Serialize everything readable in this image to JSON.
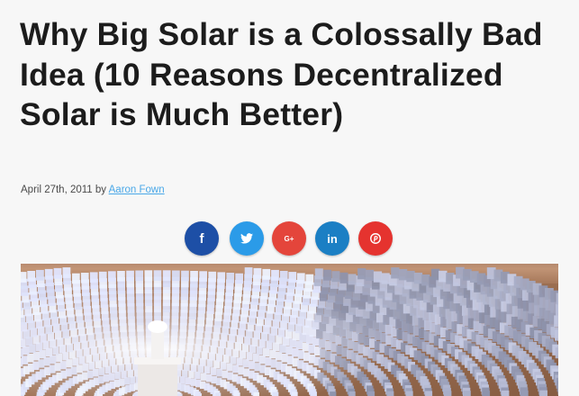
{
  "article": {
    "title": "Why Big Solar is a Colossally Bad Idea (10 Reasons Decentralized Solar is Much Better)",
    "date": "April 27th, 2011",
    "by_label": "by",
    "author": "Aaron Fown"
  },
  "share": [
    {
      "name": "facebook",
      "glyph": "f",
      "color": "#1d4fa6",
      "icon": "facebook-icon"
    },
    {
      "name": "twitter",
      "glyph": "",
      "color": "#2b9be8",
      "icon": "twitter-icon"
    },
    {
      "name": "google-plus",
      "glyph": "G+",
      "color": "#e4453b",
      "icon": "google-plus-icon"
    },
    {
      "name": "linkedin",
      "glyph": "in",
      "color": "#1b7fc4",
      "icon": "linkedin-icon"
    },
    {
      "name": "pinterest",
      "glyph": "",
      "color": "#e5332f",
      "icon": "pinterest-icon"
    }
  ],
  "hero": {
    "subject": "solar thermal heliostat field with central tower"
  }
}
